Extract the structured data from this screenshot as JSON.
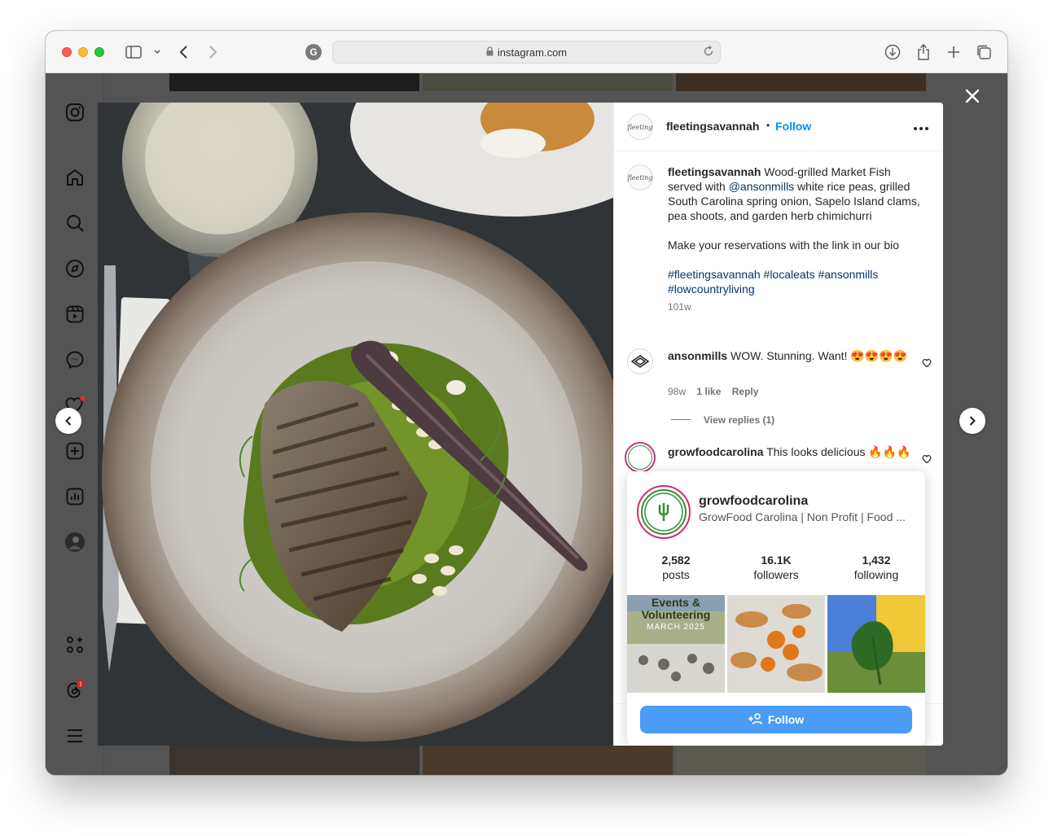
{
  "browser": {
    "url": "instagram.com"
  },
  "post": {
    "author": "fleetingsavannah",
    "author_avatar_text": "fleeting",
    "follow_label": "Follow",
    "dot": "•",
    "caption_text": "Wood-grilled Market Fish served with",
    "caption_mention": "@ansonmills",
    "caption_rest": "white rice peas, grilled South Carolina spring onion, Sapelo Island clams, pea shoots, and garden herb chimichurri",
    "caption_cta": "Make your reservations with the link in our bio",
    "hashtags": "#fleetingsavannah #localeats #ansonmills #lowcountryliving",
    "age": "101w"
  },
  "comments": [
    {
      "user": "ansonmills",
      "text": "WOW. Stunning. Want! 😍😍😍😍",
      "age": "98w",
      "likes": "1 like",
      "reply_label": "Reply",
      "view_replies": "View replies (1)"
    },
    {
      "user": "growfoodcarolina",
      "text": "This looks delicious 🔥🔥🔥"
    }
  ],
  "hover_card": {
    "username": "growfoodcarolina",
    "bio": "GrowFood Carolina | Non Profit | Food ...",
    "stats": [
      {
        "value": "2,582",
        "label": "posts"
      },
      {
        "value": "16.1K",
        "label": "followers"
      },
      {
        "value": "1,432",
        "label": "following"
      }
    ],
    "thumb1_title": "Events & Volunteering",
    "thumb1_sub": "MARCH 2025",
    "follow_label": "Follow"
  },
  "colors": {
    "accent_blue": "#0095f6",
    "follow_button": "#4a9cf7",
    "link_dark": "#00376b",
    "overlay": "#545454"
  }
}
